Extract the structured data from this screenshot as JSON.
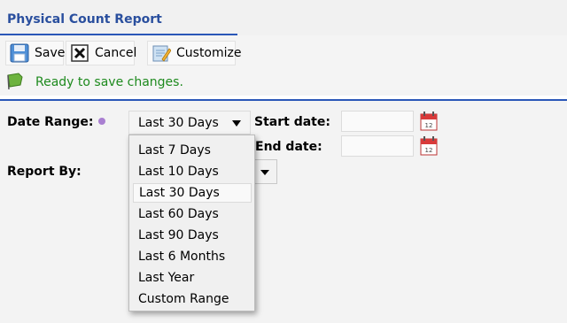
{
  "header": {
    "title": "Physical Count Report"
  },
  "toolbar": {
    "save_label": "Save",
    "cancel_label": "Cancel",
    "customize_label": "Customize",
    "icons": {
      "save": "floppy-disk-icon",
      "cancel": "x-box-icon",
      "customize": "pencil-notepad-icon"
    }
  },
  "status": {
    "text": "Ready to save changes.",
    "color": "#1e8a1e",
    "icon": "flag-icon"
  },
  "form": {
    "date_range_label": "Date Range:",
    "date_range_value": "Last 30 Days",
    "start_date_label": "Start date:",
    "start_date_value": "",
    "end_date_label": "End date:",
    "end_date_value": "",
    "report_by_label": "Report By:",
    "report_by_value": ""
  },
  "dropdown": {
    "options": [
      "Last 7 Days",
      "Last 10 Days",
      "Last 30 Days",
      "Last 60 Days",
      "Last 90 Days",
      "Last 6 Months",
      "Last Year",
      "Custom Range"
    ],
    "selected": "Last 30 Days"
  },
  "colors": {
    "accent": "#2a57b8",
    "title": "#2a4f9e",
    "status_green": "#1e8a1e"
  }
}
